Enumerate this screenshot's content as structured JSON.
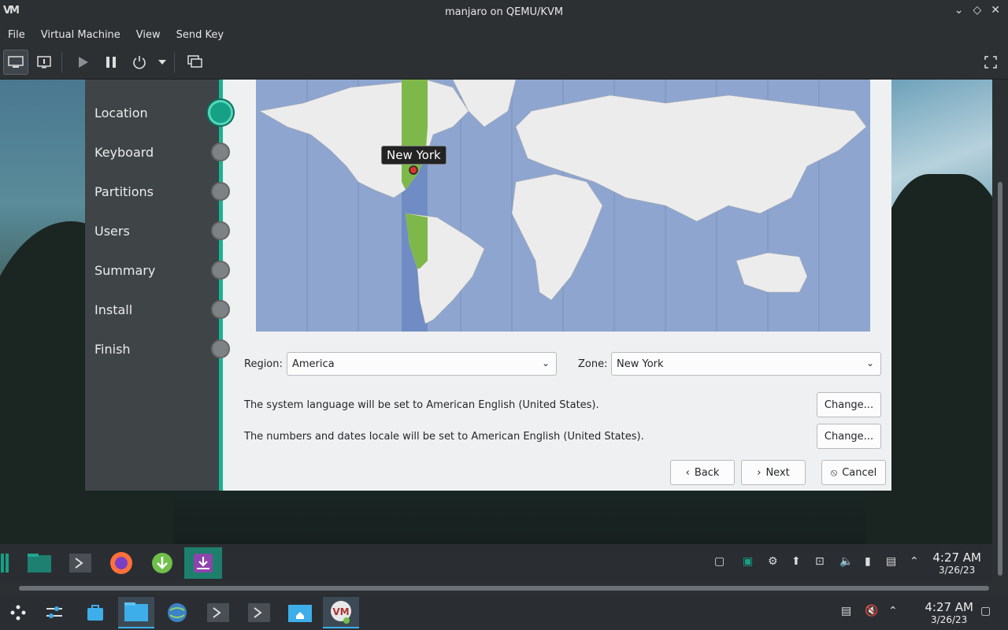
{
  "window": {
    "title": "manjaro on QEMU/KVM",
    "logo_text": "VM"
  },
  "menubar": [
    "File",
    "Virtual Machine",
    "View",
    "Send Key"
  ],
  "installer": {
    "steps": [
      "Location",
      "Keyboard",
      "Partitions",
      "Users",
      "Summary",
      "Install",
      "Finish"
    ],
    "current_step": "Location",
    "map_pin_label": "New York",
    "region_label": "Region:",
    "region_value": "America",
    "zone_label": "Zone:",
    "zone_value": "New York",
    "language_text": "The system language will be set to American English (United States).",
    "locale_text": "The numbers and dates locale will be set to American English (United States).",
    "change_label": "Change...",
    "back_label": "Back",
    "next_label": "Next",
    "cancel_label": "Cancel"
  },
  "guest_panel": {
    "time": "4:27 AM",
    "date": "3/26/23"
  },
  "host_panel": {
    "time": "4:27 AM",
    "date": "3/26/23"
  },
  "colors": {
    "accent": "#1ab394",
    "sidebar": "#3f4447",
    "ocean": "#8ea6cf",
    "timezone_highlight": "#7fb84a"
  },
  "icons": {
    "toolbar": [
      "console-icon",
      "details-icon",
      "play-icon",
      "pause-icon",
      "power-icon",
      "dropdown-icon",
      "snapshot-icon",
      "fullscreen-icon"
    ]
  }
}
